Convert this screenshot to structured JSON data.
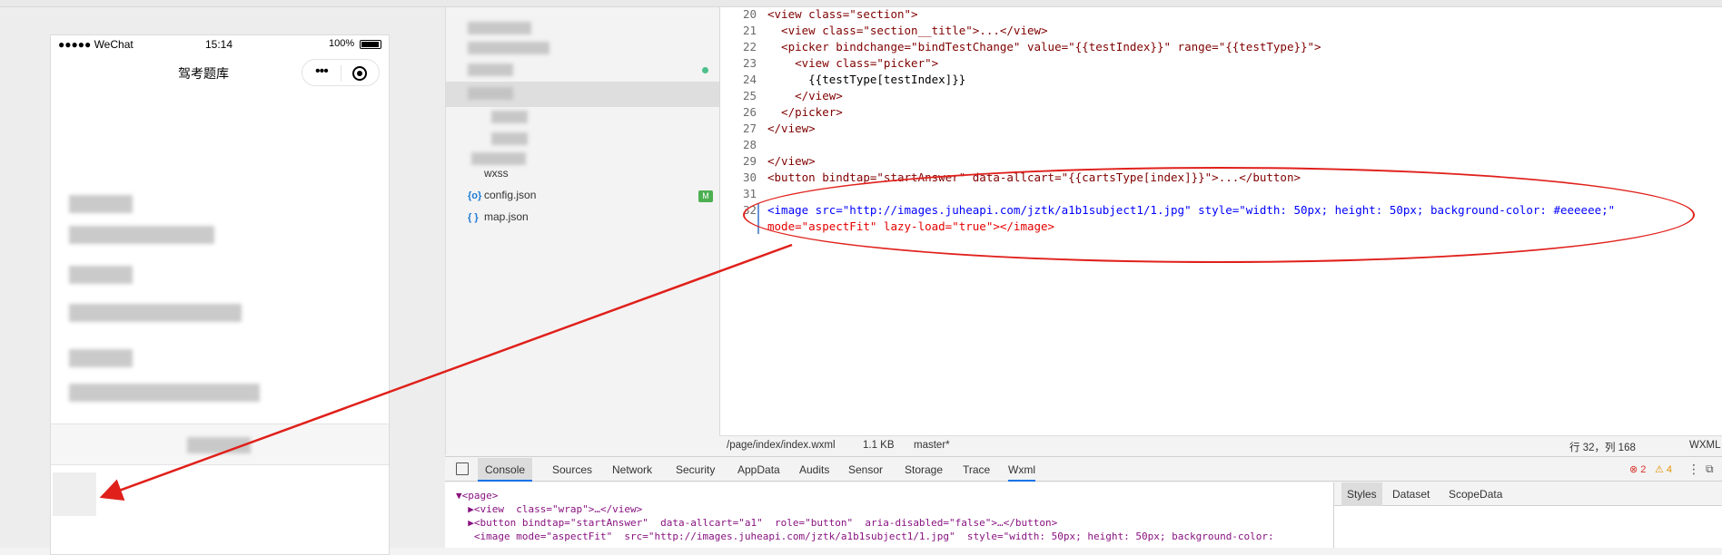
{
  "simulator": {
    "status": {
      "carrier": "●●●●● WeChat",
      "time": "15:14",
      "battery": "100%"
    },
    "nav_title": "驾考题库",
    "capsule_dots": "•••"
  },
  "file_tree": {
    "items": [
      {
        "icon": "",
        "label": "wxss"
      },
      {
        "icon": "{o}",
        "label": "config.json"
      },
      {
        "icon": "{ }",
        "label": "map.json"
      }
    ],
    "badge": "M"
  },
  "editor": {
    "lines": [
      {
        "n": "20",
        "code": "<view class=\"section\">"
      },
      {
        "n": "21",
        "code": "  <view class=\"section__title\">...</view>"
      },
      {
        "n": "22",
        "code": "  <picker bindchange=\"bindTestChange\" value=\"{{testIndex}}\" range=\"{{testType}}\">"
      },
      {
        "n": "23",
        "code": "    <view class=\"picker\">"
      },
      {
        "n": "24",
        "code": "      {{testType[testIndex]}}"
      },
      {
        "n": "25",
        "code": "    </view>"
      },
      {
        "n": "26",
        "code": "  </picker>"
      },
      {
        "n": "27",
        "code": "</view>"
      },
      {
        "n": "28",
        "code": ""
      },
      {
        "n": "29",
        "code": "</view>"
      },
      {
        "n": "30",
        "code": "<button bindtap=\"startAnswer\" data-allcart=\"{{cartsType[index]}}\">...</button>"
      },
      {
        "n": "31",
        "code": ""
      },
      {
        "n": "32",
        "code": "<image src=\"http://images.juheapi.com/jztk/a1b1subject1/1.jpg\" style=\"width: 50px; height: 50px; background-color: #eeeeee;\""
      },
      {
        "n": "",
        "code": "mode=\"aspectFit\" lazy-load=\"true\"></image>"
      }
    ],
    "status": {
      "path": "/page/index/index.wxml",
      "size": "1.1 KB",
      "branch": "master*",
      "position": "行 32，列 168",
      "lang": "WXML"
    }
  },
  "devtools": {
    "tabs": [
      "Console",
      "Sources",
      "Network",
      "Security",
      "AppData",
      "Audits",
      "Sensor",
      "Storage",
      "Trace",
      "Wxml"
    ],
    "errors": "2",
    "warnings": "4",
    "wxml_lines": [
      "▼<page>",
      "  ▶<view  class=\"wrap\">…</view>",
      "  ▶<button bindtap=\"startAnswer\"  data-allcart=\"a1\"  role=\"button\"  aria-disabled=\"false\">…</button>",
      "   <image mode=\"aspectFit\"  src=\"http://images.juheapi.com/jztk/a1b1subject1/1.jpg\"  style=\"width: 50px; height: 50px; background-color:"
    ],
    "side_tabs": [
      "Styles",
      "Dataset",
      "ScopeData"
    ]
  }
}
